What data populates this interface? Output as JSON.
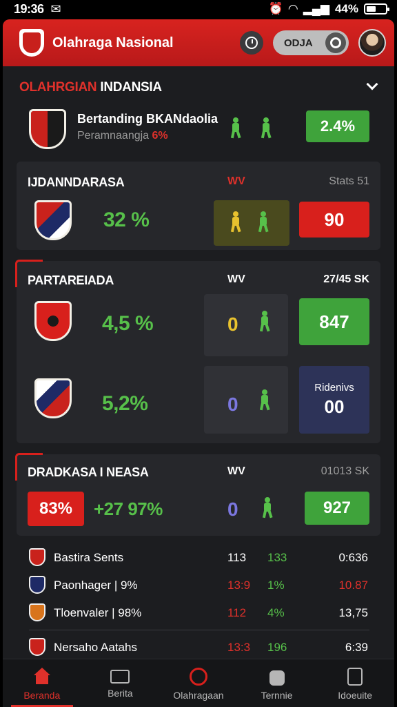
{
  "status_bar": {
    "time": "19:36",
    "battery": "44%"
  },
  "header": {
    "title": "Olahraga Nasional",
    "toggle_label": "ODJA"
  },
  "section1": {
    "title_red": "OLAHRGIAN",
    "title_white": "INDANSIA",
    "row_name": "Bertanding BKANdaolia",
    "row_sub": "Peramnaangja",
    "row_sub_hl": "6%",
    "pill": "2.4%"
  },
  "card1": {
    "title": "IJDANNDARASA",
    "col_head": "WV",
    "col_head2": "Stats 51",
    "pct": "32 %",
    "pill": "90"
  },
  "card2": {
    "title": "PARTAREIADA",
    "col_head": "WV",
    "col_head2": "27/45 SK",
    "rows": [
      {
        "pct": "4,5 %",
        "score": "0",
        "score_color": "#e8c22e",
        "pill_top": "",
        "pill_value": "847"
      },
      {
        "pct": "5,2%",
        "score": "0",
        "score_color": "#7b77e0",
        "pill_top": "Ridenivs",
        "pill_value": "00"
      }
    ]
  },
  "card3": {
    "title": "DRADKASA I NEASA",
    "col_head": "WV",
    "col_head2": "01013 SK",
    "red_pill": "83%",
    "trend": "+27 97%",
    "score": "0",
    "pill": "927"
  },
  "list": [
    {
      "name": "Bastira Sents",
      "c1": "113",
      "c2": "133",
      "c3": "0:636",
      "c1_color": "#ffffff",
      "c3_color": "#ffffff"
    },
    {
      "name": "Paonhager | 9%",
      "c1": "13:9",
      "c2": "1%",
      "c3": "10.87",
      "c1_color": "#e0312b",
      "c3_color": "#e0312b"
    },
    {
      "name": "Tloenvaler | 98%",
      "c1": "112",
      "c2": "4%",
      "c3": "13,75",
      "c1_color": "#e0312b",
      "c3_color": "#ffffff"
    },
    {
      "name": "Nersaho Aatahs",
      "c1": "13:3",
      "c2": "196",
      "c3": "6:39",
      "c1_color": "#e0312b",
      "c3_color": "#ffffff"
    }
  ],
  "nav": [
    {
      "label": "Beranda",
      "icon": "home-icon"
    },
    {
      "label": "Berita",
      "icon": "tv-icon"
    },
    {
      "label": "Olahragaan",
      "icon": "ball-icon"
    },
    {
      "label": "Ternnie",
      "icon": "bag-icon"
    },
    {
      "label": "Idoeuite",
      "icon": "doc-icon"
    }
  ]
}
